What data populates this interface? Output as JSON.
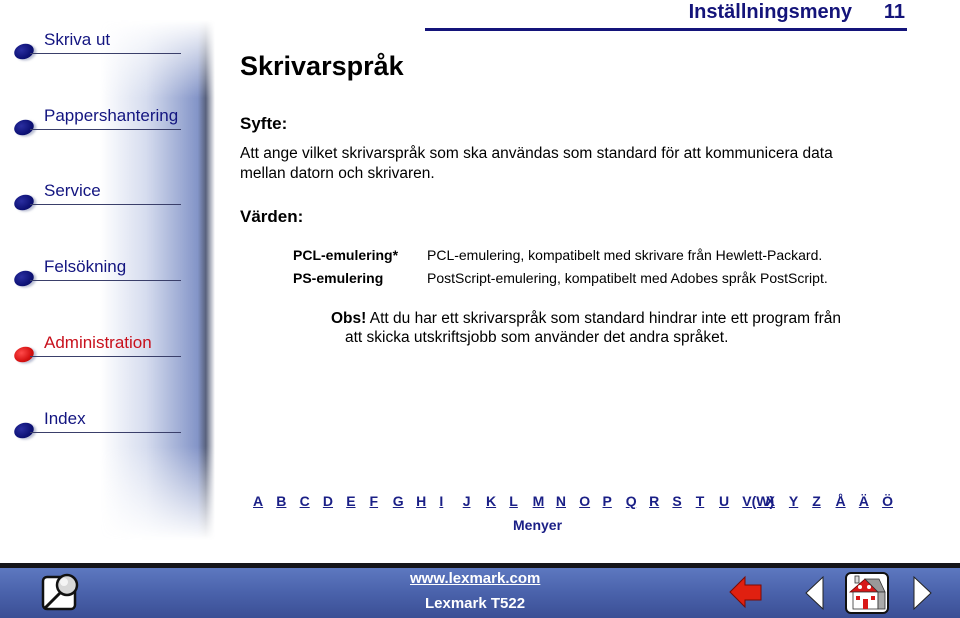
{
  "header": {
    "section_title": "Inställningsmeny",
    "page_number": "11"
  },
  "sidebar": {
    "items": [
      {
        "label": "Skriva ut",
        "active": false
      },
      {
        "label": "Pappershantering",
        "active": false
      },
      {
        "label": "Service",
        "active": false
      },
      {
        "label": "Felsökning",
        "active": false
      },
      {
        "label": "Administration",
        "active": true
      },
      {
        "label": "Index",
        "active": false
      }
    ]
  },
  "main": {
    "title": "Skrivarspråk",
    "purpose_heading": "Syfte:",
    "purpose_text": "Att ange vilket skrivarspråk som ska användas som standard för att kommunicera data mellan datorn och skrivaren.",
    "values_heading": "Värden:",
    "values": [
      {
        "term": "PCL-emulering*",
        "description": "PCL-emulering, kompatibelt med skrivare från Hewlett-Packard."
      },
      {
        "term": "PS-emulering",
        "description": "PostScript-emulering, kompatibelt med Adobes språk PostScript."
      }
    ],
    "note_label": "Obs!",
    "note_text_line1": "Att du har ett skrivarspråk som standard hindrar inte ett program från",
    "note_text_line2": "att skicka utskriftsjobb som använder det andra språket."
  },
  "index_letters": [
    "A",
    "B",
    "C",
    "D",
    "E",
    "F",
    "G",
    "H",
    "I",
    "J",
    "K",
    "L",
    "M",
    "N",
    "O",
    "P",
    "Q",
    "R",
    "S",
    "T",
    "U",
    "V(W)",
    "X",
    "Y",
    "Z",
    "Å",
    "Ä",
    "Ö"
  ],
  "menus_link": "Menyer",
  "footer": {
    "url": "www.lexmark.com",
    "model": "Lexmark T522",
    "icons": [
      "search-icon",
      "back-icon",
      "previous-page-icon",
      "home-icon",
      "next-page-icon"
    ]
  },
  "colors": {
    "nav": "#131580",
    "nav_active": "#c8101c",
    "header": "#14147a",
    "footer_bg": "#4a62ab"
  }
}
